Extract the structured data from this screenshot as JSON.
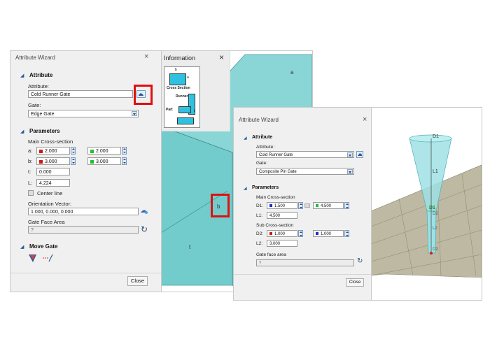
{
  "left": {
    "dialog": {
      "title": "Attribute Wizard",
      "close": "×",
      "attribute_section": "Attribute",
      "attribute_label": "Attribute:",
      "attribute_value": "Cold Runner Gate",
      "gate_label": "Gate:",
      "gate_value": "Edge Gate",
      "parameters_section": "Parameters",
      "main_cs_label": "Main Cross-section",
      "a_label": "a:",
      "a_value": "2.000",
      "a_value2": "2.000",
      "b_label": "b:",
      "b_value": "3.000",
      "b_value2": "3.000",
      "t_label": "t:",
      "t_value": "0.000",
      "L_label": "L:",
      "L_value": "4.224",
      "center_line_label": "Center line",
      "orientation_label": "Orientation Vector:",
      "orientation_value": "1.000, 0.000, 0.000",
      "gate_face_area_label": "Gate Face Area",
      "gate_face_area_value": "?",
      "move_gate_section": "Move Gate",
      "close_button": "Close"
    },
    "info": {
      "title": "Information",
      "close": "×",
      "thumb_cross_section": "Cross Section",
      "thumb_runner": "Runner",
      "thumb_part": "Part",
      "thumb_a": "a",
      "thumb_b": "b",
      "thumb_t": "t"
    },
    "viewport": {
      "label_a": "a",
      "label_b": "b",
      "label_t": "t"
    }
  },
  "right": {
    "dialog": {
      "title": "Attribute Wizard",
      "close": "×",
      "attribute_section": "Attribute",
      "attribute_label": "Attribute:",
      "attribute_value": "Cold Runner Gate",
      "gate_label": "Gate:",
      "gate_value": "Composite Pin Gate",
      "parameters_section": "Parameters",
      "main_cs_label": "Main Cross-section",
      "d1_label": "D1:",
      "d1_value": "1.500",
      "d1_value2": "4.500",
      "l1_label": "L1:",
      "l1_value": "4.500",
      "sub_cs_label": "Sub Cross-section",
      "d2_label": "D2:",
      "d2_value": "1.000",
      "d2_value2": "1.000",
      "l2_label": "L2:",
      "l2_value": "3.000",
      "gate_face_area_label": "Gate face area",
      "gate_face_area_value": "?",
      "close_button": "Close"
    },
    "viewport": {
      "label_d1_top": "D1",
      "label_l1": "L1",
      "label_d1": "D1",
      "label_d2": "D2",
      "label_l2": "L2",
      "label_d2_bottom": "D2"
    }
  },
  "colors": {
    "highlight_red": "#e01010",
    "swatch_red": "#d01818",
    "swatch_green": "#22c030",
    "swatch_blue": "#1c2fd0",
    "model_teal": "#6fc8c8",
    "section_blue": "#1f5c9e"
  }
}
